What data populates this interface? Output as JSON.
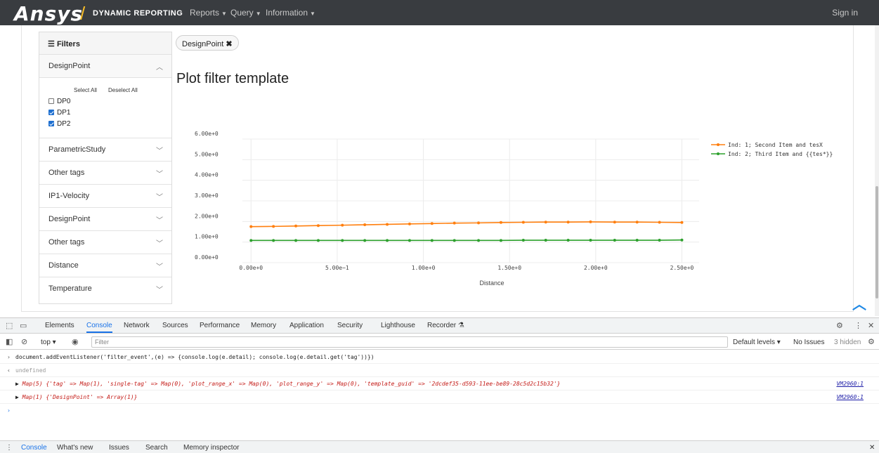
{
  "navbar": {
    "brand": "Ansys",
    "brand_sub": "DYNAMIC REPORTING",
    "menu": [
      "Reports",
      "Query",
      "Information"
    ],
    "signin": "Sign in"
  },
  "sidebar": {
    "header": "Filters",
    "open_section": {
      "title": "DesignPoint",
      "select_all": "Select All",
      "deselect_all": "Deselect All",
      "options": [
        {
          "label": "DP0",
          "checked": false
        },
        {
          "label": "DP1",
          "checked": true
        },
        {
          "label": "DP2",
          "checked": true
        }
      ]
    },
    "sections": [
      "ParametricStudy",
      "Other tags",
      "IP1-Velocity",
      "DesignPoint",
      "Other tags",
      "Distance",
      "Temperature"
    ]
  },
  "active_filter": "DesignPoint",
  "page_title": "Plot filter template",
  "chart_data": {
    "type": "line",
    "xlabel": "Distance",
    "ylabel": "",
    "xlim": [
      -0.05,
      2.6
    ],
    "ylim": [
      0,
      6
    ],
    "x_ticks": [
      "0.00e+0",
      "5.00e−1",
      "1.00e+0",
      "1.50e+0",
      "2.00e+0",
      "2.50e+0"
    ],
    "y_ticks": [
      "0.00e+0",
      "1.00e+0",
      "2.00e+0",
      "3.00e+0",
      "4.00e+0",
      "5.00e+0",
      "6.00e+0"
    ],
    "x": [
      0.0,
      0.13,
      0.26,
      0.39,
      0.53,
      0.66,
      0.79,
      0.92,
      1.05,
      1.18,
      1.32,
      1.45,
      1.58,
      1.71,
      1.84,
      1.97,
      2.11,
      2.24,
      2.37,
      2.5
    ],
    "series": [
      {
        "name": "Ind: 1; Second Item and tesX",
        "color": "#ff7f0e",
        "values": [
          1.75,
          1.76,
          1.78,
          1.8,
          1.82,
          1.84,
          1.86,
          1.88,
          1.9,
          1.92,
          1.93,
          1.95,
          1.96,
          1.97,
          1.97,
          1.98,
          1.97,
          1.97,
          1.96,
          1.95
        ]
      },
      {
        "name": "Ind: 2; Third Item and {{tes*}}",
        "color": "#2ca02c",
        "values": [
          1.08,
          1.08,
          1.08,
          1.08,
          1.08,
          1.08,
          1.08,
          1.08,
          1.08,
          1.08,
          1.08,
          1.08,
          1.09,
          1.09,
          1.09,
          1.09,
          1.09,
          1.09,
          1.09,
          1.1
        ]
      }
    ],
    "legend": "top-right",
    "grid": true
  },
  "devtools": {
    "tabs": [
      "Elements",
      "Console",
      "Network",
      "Sources",
      "Performance",
      "Memory",
      "Application",
      "Security",
      "Lighthouse",
      "Recorder"
    ],
    "active_tab": "Console",
    "context": "top",
    "filter_placeholder": "Filter",
    "levels": "Default levels",
    "issues": "No Issues",
    "hidden": "3 hidden",
    "command": "document.addEventListener('filter_event',(e) => {console.log(e.detail); console.log(e.detail.get('tag'))})",
    "result": "undefined",
    "log1": "Map(5) {'tag' => Map(1), 'single-tag' => Map(0), 'plot_range_x' => Map(0), 'plot_range_y' => Map(0), 'template_guid' => '2dcdef35-d593-11ee-be89-28c5d2c15b32'}",
    "log2": "Map(1) {'DesignPoint' => Array(1)}",
    "source": "VM2960:1",
    "drawer_tabs": [
      "Console",
      "What's new",
      "Issues",
      "Search",
      "Memory inspector"
    ]
  }
}
